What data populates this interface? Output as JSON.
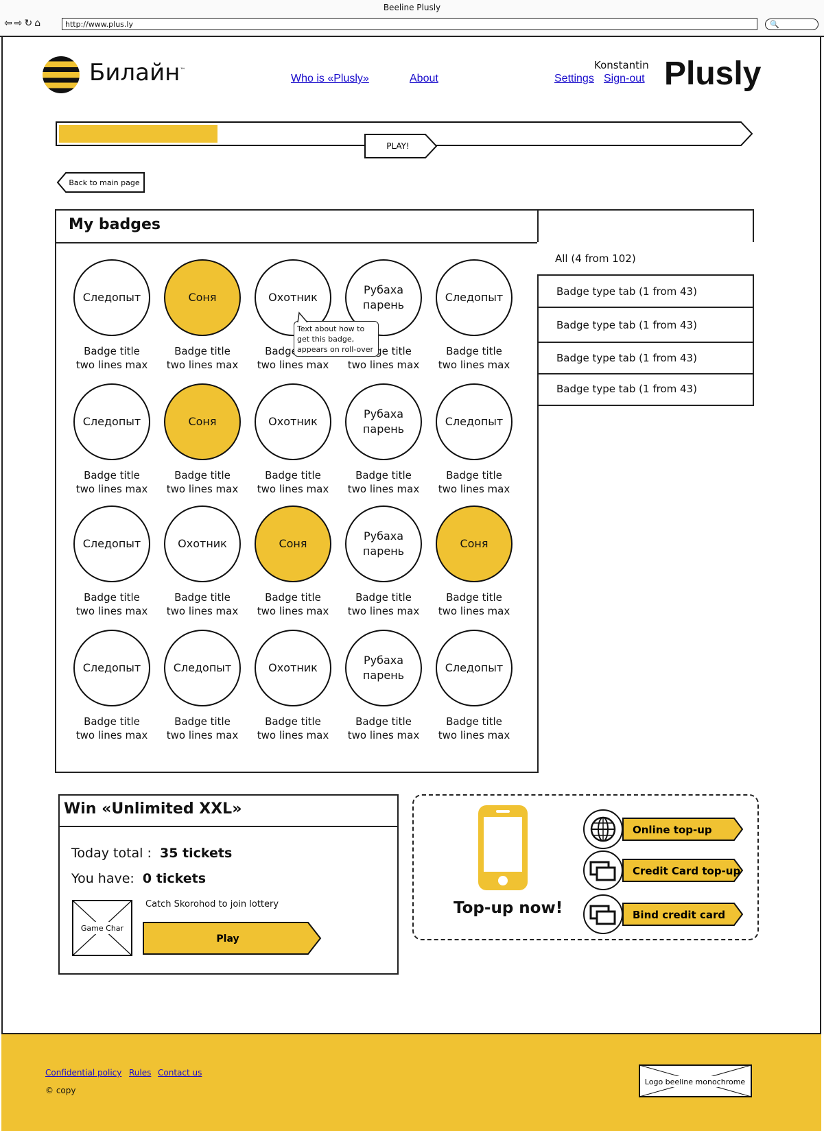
{
  "window": {
    "title": "Beeline Plusly",
    "url": "http://www.plus.ly"
  },
  "header": {
    "logo_text": "Билайн",
    "logo_tm": "™",
    "nav": [
      "Who is «Plusly»",
      "About"
    ],
    "user": "Konstantin",
    "settings": "Settings",
    "signout": "Sign-out",
    "brand": "Plusly"
  },
  "progress": {
    "fill_fraction": 0.23,
    "play_label": "PLAY!"
  },
  "back_label": "Back to main page",
  "badges": {
    "title": "My badges",
    "tooltip": "Text about how to get this badge, appears on roll-over",
    "title_line1": "Badge title",
    "title_line2": "two lines max",
    "rows": [
      [
        {
          "name": "Следопыт",
          "earned": false
        },
        {
          "name": "Соня",
          "earned": true
        },
        {
          "name": "Охотник",
          "earned": false
        },
        {
          "name": "Рубаха парень",
          "earned": false
        },
        {
          "name": "Следопыт",
          "earned": false
        }
      ],
      [
        {
          "name": "Следопыт",
          "earned": false
        },
        {
          "name": "Соня",
          "earned": true
        },
        {
          "name": "Охотник",
          "earned": false
        },
        {
          "name": "Рубаха парень",
          "earned": false
        },
        {
          "name": "Следопыт",
          "earned": false
        }
      ],
      [
        {
          "name": "Следопыт",
          "earned": false
        },
        {
          "name": "Охотник",
          "earned": false
        },
        {
          "name": "Соня",
          "earned": true
        },
        {
          "name": "Рубаха парень",
          "earned": false
        },
        {
          "name": "Соня",
          "earned": true
        }
      ],
      [
        {
          "name": "Следопыт",
          "earned": false
        },
        {
          "name": "Следопыт",
          "earned": false
        },
        {
          "name": "Охотник",
          "earned": false
        },
        {
          "name": "Рубаха парень",
          "earned": false
        },
        {
          "name": "Следопыт",
          "earned": false
        }
      ]
    ],
    "tabs": [
      "All (4 from 102)",
      "Badge type tab (1 from 43)",
      "Badge type tab (1 from 43)",
      "Badge type tab (1 from 43)",
      "Badge type tab (1 from 43)"
    ]
  },
  "lottery": {
    "title": "Win «Unlimited XXL»",
    "today_label": "Today total  :",
    "today_value": "35 tickets",
    "have_label": "You have:",
    "have_value": "0 tickets",
    "game_char": "Game Char",
    "catch_text": "Catch Skorohod to join lottery",
    "play_label": "Play"
  },
  "topup": {
    "title": "Top-up now!",
    "buttons": [
      {
        "label": "Online top-up",
        "icon": "globe-icon"
      },
      {
        "label": "Credit Card top-up",
        "icon": "cards-icon"
      },
      {
        "label": "Bind credit card",
        "icon": "cards-icon"
      }
    ]
  },
  "footer": {
    "links": [
      "Confidential policy",
      "Rules",
      "Contact us"
    ],
    "copy": "© copy",
    "logo_placeholder": "Logo beeline monochrome"
  },
  "colors": {
    "accent": "#f0c232",
    "link": "#1a0dcc",
    "ink": "#111111"
  }
}
